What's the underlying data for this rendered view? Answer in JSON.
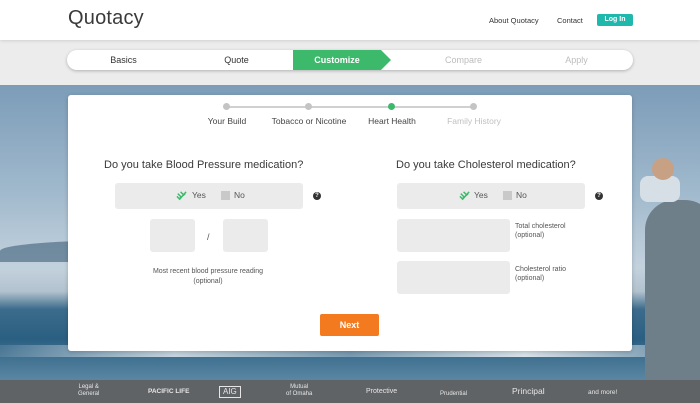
{
  "header": {
    "logo": "Quotacy",
    "nav": {
      "about": "About Quotacy",
      "contact": "Contact",
      "login": "Log In"
    }
  },
  "progress_steps": [
    {
      "label": "Basics",
      "state": "done"
    },
    {
      "label": "Quote",
      "state": "done"
    },
    {
      "label": "Customize",
      "state": "active"
    },
    {
      "label": "Compare",
      "state": "pending"
    },
    {
      "label": "Apply",
      "state": "pending"
    }
  ],
  "sub_steps": [
    {
      "label": "Your Build",
      "state": "done"
    },
    {
      "label": "Tobacco or Nicotine",
      "state": "done"
    },
    {
      "label": "Heart Health",
      "state": "active"
    },
    {
      "label": "Family History",
      "state": "pending"
    }
  ],
  "blood_pressure": {
    "question": "Do you take Blood Pressure medication?",
    "yes_label": "Yes",
    "no_label": "No",
    "selected": "Yes",
    "systolic_value": "",
    "diastolic_value": "",
    "separator": "/",
    "note_line1": "Most recent blood pressure reading",
    "note_line2": "(optional)"
  },
  "cholesterol": {
    "question": "Do you take Cholesterol medication?",
    "yes_label": "Yes",
    "no_label": "No",
    "selected": "Yes",
    "total_label": "Total cholesterol",
    "total_optional": "(optional)",
    "ratio_label": "Cholesterol ratio",
    "ratio_optional": "(optional)",
    "total_value": "",
    "ratio_value": ""
  },
  "help_glyph": "?",
  "next_label": "Next",
  "partners": {
    "lg_line1": "Legal &",
    "lg_line2": "General",
    "pacific": "PACIFIC LIFE",
    "aig": "AIG",
    "moo_line1": "Mutual",
    "moo_line2": "of Omaha",
    "protective": "Protective",
    "prudential": "Prudential",
    "principal": "Principal",
    "more": "and more!"
  },
  "colors": {
    "brand_teal": "#1fb8ac",
    "active_green": "#3cb96b",
    "next_orange": "#f47a20",
    "footer_gray": "#606366"
  },
  "icons": [
    "check-scribble-icon",
    "help-icon",
    "partner-logo"
  ]
}
